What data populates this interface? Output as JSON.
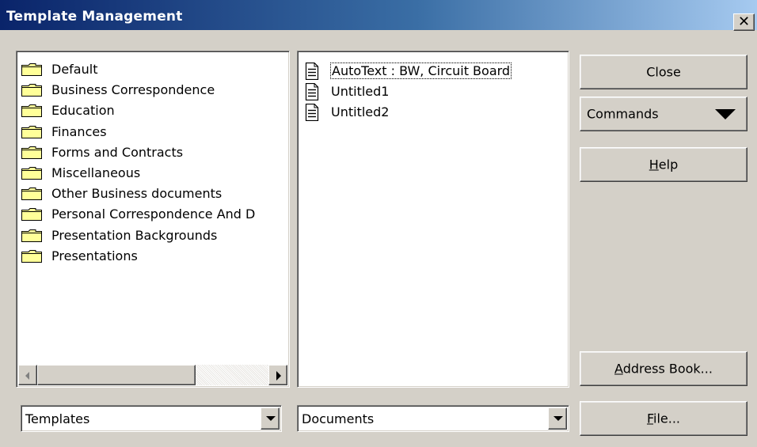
{
  "window": {
    "title": "Template Management",
    "close_glyph": "✕"
  },
  "categories": [
    "Default",
    "Business Correspondence",
    "Education",
    "Finances",
    "Forms and Contracts",
    "Miscellaneous",
    "Other Business documents",
    "Personal Correspondence And D",
    "Presentation Backgrounds",
    "Presentations"
  ],
  "templates": [
    "AutoText : BW, Circuit Board",
    "Untitled1",
    "Untitled2"
  ],
  "selected_template_index": 0,
  "left_combo": {
    "value": "Templates"
  },
  "right_combo": {
    "value": "Documents"
  },
  "buttons": {
    "close": "Close",
    "commands": "Commands",
    "help": {
      "mnemonic": "H",
      "rest": "elp"
    },
    "address_book": {
      "mnemonic": "A",
      "rest": "ddress Book..."
    },
    "file": {
      "mnemonic": "F",
      "rest": "ile..."
    }
  },
  "icons": {
    "folder": "folder-icon",
    "document": "document-icon"
  },
  "colors": {
    "titlebar_start": "#0a246a",
    "titlebar_end": "#a6caf0",
    "dialog_bg": "#d4d0c8",
    "folder_fill": "#ffff99"
  }
}
